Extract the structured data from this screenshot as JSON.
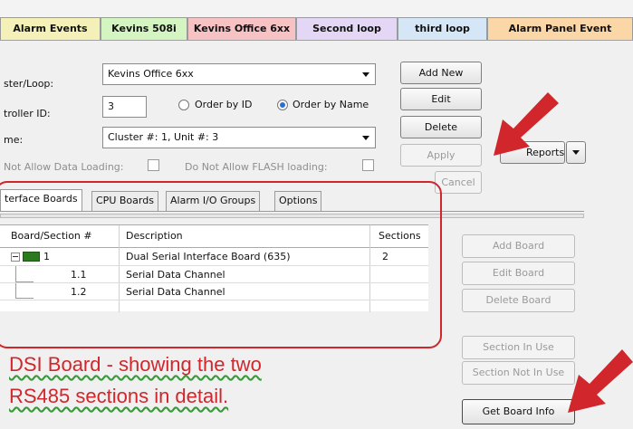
{
  "tabs": [
    {
      "label": "Alarm Events",
      "color": "#f4f0b8"
    },
    {
      "label": "Kevins 508i",
      "color": "#d4f4c2"
    },
    {
      "label": "Kevins Office 6xx",
      "color": "#f7c2c4"
    },
    {
      "label": "Second loop",
      "color": "#e4d7f5"
    },
    {
      "label": "third loop",
      "color": "#d5e6f7"
    },
    {
      "label": "Alarm Panel Event",
      "color": "#fbd6a6"
    }
  ],
  "form": {
    "master_loop_label": "ster/Loop:",
    "master_loop_value": "Kevins Office 6xx",
    "controller_id_label": "troller ID:",
    "controller_id_value": "3",
    "order_by_id_label": "Order by ID",
    "order_by_name_label": "Order by Name",
    "name_label": "me:",
    "name_value": "Cluster #: 1, Unit #: 3",
    "not_allow_data_label": "Not Allow Data Loading:",
    "not_allow_flash_label": "Do Not Allow FLASH loading:"
  },
  "buttons": {
    "add_new": "Add New",
    "edit": "Edit",
    "delete": "Delete",
    "apply": "Apply",
    "cancel": "Cancel",
    "reports": "Reports"
  },
  "inner_tabs": [
    "terface Boards",
    "CPU Boards",
    "Alarm I/O Groups",
    "Options"
  ],
  "table": {
    "headers": [
      "Board/Section #",
      "Description",
      "Sections"
    ],
    "rows": [
      {
        "id": "1",
        "description": "Dual Serial Interface Board (635)",
        "sections": "2"
      },
      {
        "id": "1.1",
        "description": "Serial Data Channel",
        "sections": ""
      },
      {
        "id": "1.2",
        "description": "Serial Data Channel",
        "sections": ""
      }
    ]
  },
  "side_buttons": {
    "add_board": "Add Board",
    "edit_board": "Edit Board",
    "delete_board": "Delete Board",
    "section_in_use": "Section In Use",
    "section_not_in_use": "Section Not In Use",
    "get_board_info": "Get Board Info"
  },
  "annotation": {
    "line1": "DSI Board - showing the two",
    "line2": "RS485 sections in detail.",
    "color": "#d0262c"
  }
}
